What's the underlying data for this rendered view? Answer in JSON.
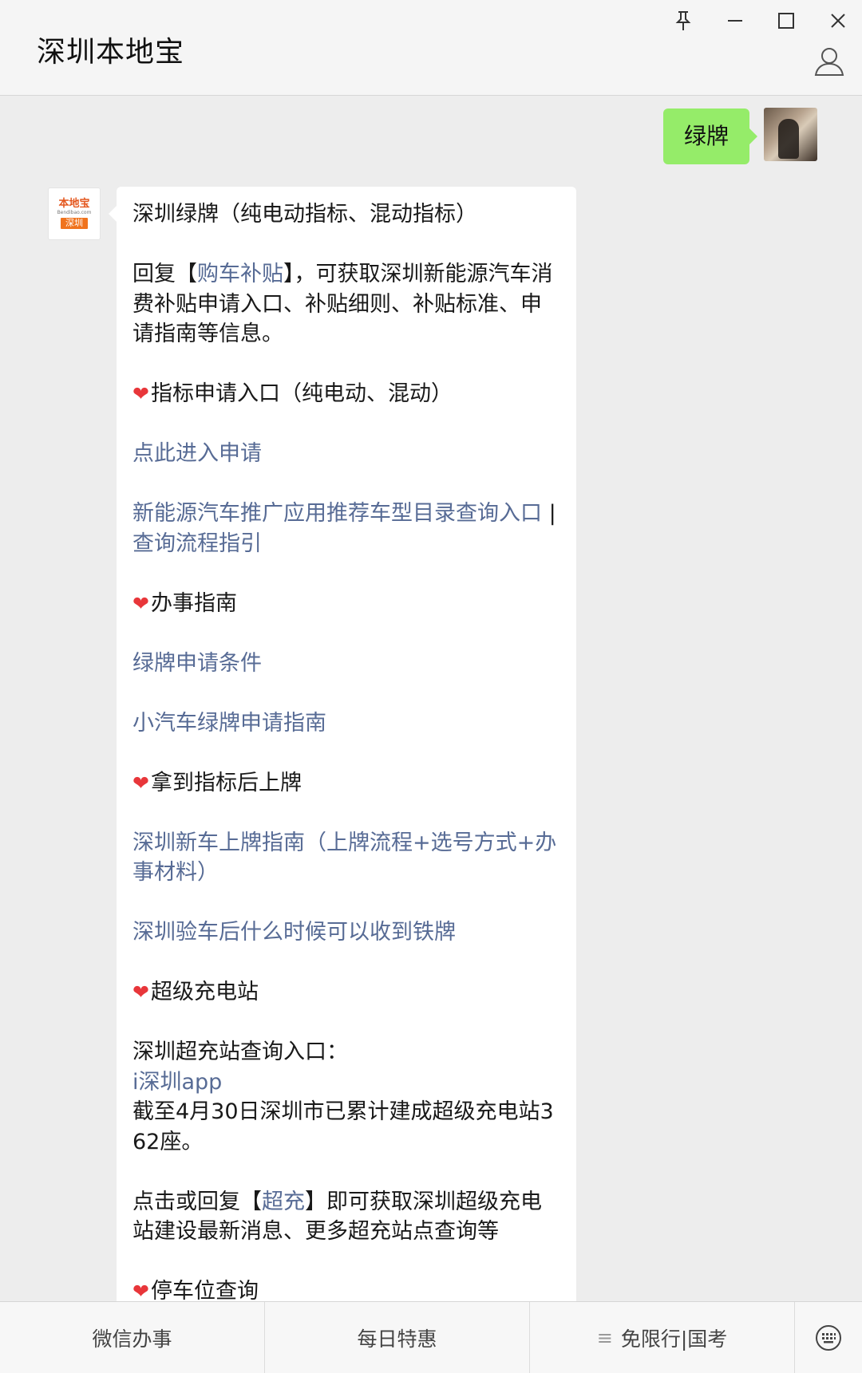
{
  "header": {
    "title": "深圳本地宝"
  },
  "chat": {
    "user_message": "绿牌",
    "bot_lines": {
      "l1": "深圳绿牌（纯电动指标、混动指标）",
      "l2_pre": "回复【",
      "l2_link": "购车补贴",
      "l2_post": "】，可获取深圳新能源汽车消费补贴申请入口、补贴细则、补贴标准、申请指南等信息。",
      "h1": "指标申请入口（纯电动、混动）",
      "link_apply": "点此进入申请",
      "link_catalog": "新能源汽车推广应用推荐车型目录查询入口",
      "sep": " | ",
      "link_flow": "查询流程指引",
      "h2": "办事指南",
      "link_conditions": "绿牌申请条件",
      "link_guide": "小汽车绿牌申请指南",
      "h3": "拿到指标后上牌",
      "link_plate": "深圳新车上牌指南（上牌流程+选号方式+办事材料）",
      "link_iron": "深圳验车后什么时候可以收到铁牌",
      "h4": "超级充电站",
      "charge_label": "深圳超充站查询入口：",
      "link_app": "i深圳app",
      "charge_stat": "截至4月30日深圳市已累计建成超级充电站362座。",
      "reply_pre": "点击或回复【",
      "reply_link": "超充",
      "reply_post": "】即可获取深圳超级充电站建设最新消息、更多超充站点查询等",
      "h5": "停车位查询"
    },
    "heart_glyph": "❤"
  },
  "menu": {
    "item1": "微信办事",
    "item2": "每日特惠",
    "item3": "免限行|国考",
    "item3_icon": "≡"
  },
  "avatar_bot": {
    "logo_text": "本地宝",
    "logo_url": "Bendibao.com",
    "logo_city": "深圳"
  },
  "colors": {
    "link": "#576b95",
    "user_bubble": "#95ec69",
    "heart": "#e8363a",
    "logo_orange": "#f0731d"
  },
  "icons": [
    "pin-icon",
    "minimize-icon",
    "maximize-icon",
    "close-icon",
    "profile-icon",
    "keyboard-icon",
    "heart-icon",
    "menu-lines-icon"
  ]
}
